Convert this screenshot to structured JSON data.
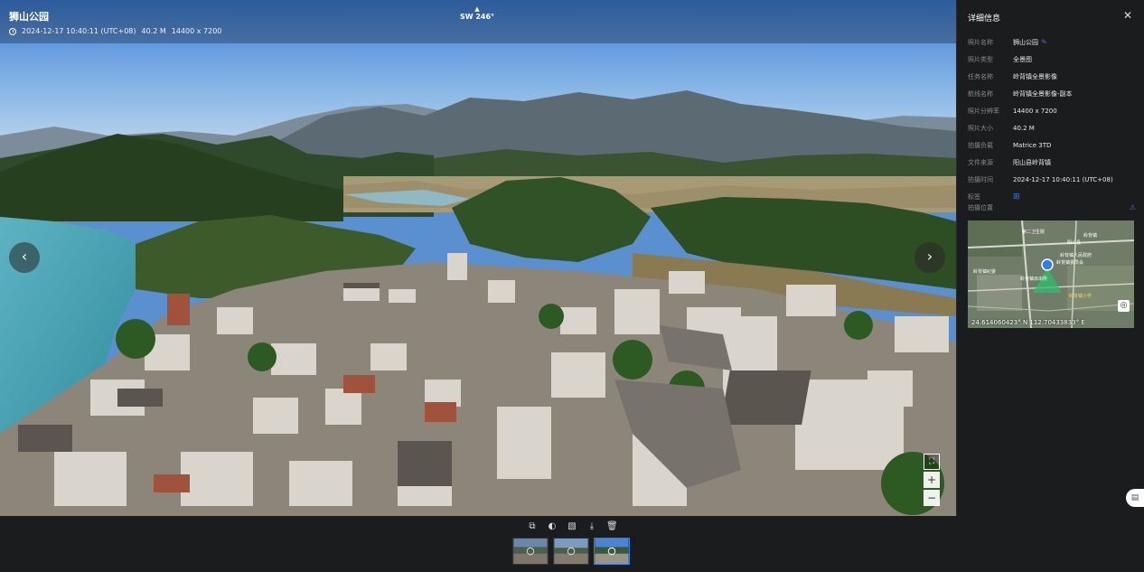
{
  "viewer": {
    "title": "狮山公园",
    "datetime": "2024-12-17 10:40:11 (UTC+08)",
    "size": "40.2 M",
    "resolution": "14400 x 7200",
    "compass_arrow": "▲",
    "compass": "SW 246°",
    "prev_label": "‹",
    "next_label": "›",
    "fullscreen_label": "⛶",
    "zoom_in_label": "+",
    "zoom_out_label": "−"
  },
  "panel": {
    "title": "详细信息",
    "close_label": "✕",
    "rows": [
      {
        "label": "照片名称",
        "value": "狮山公园"
      },
      {
        "label": "照片类型",
        "value": "全景图"
      },
      {
        "label": "任务名称",
        "value": "岭背镇全景影像"
      },
      {
        "label": "航线名称",
        "value": "岭背镇全景影像-副本"
      },
      {
        "label": "照片分辨率",
        "value": "14400 x 7200"
      },
      {
        "label": "照片大小",
        "value": "40.2 M"
      },
      {
        "label": "拍摄负载",
        "value": "Matrice 3TD"
      },
      {
        "label": "文件来源",
        "value": "阳山县岭背镇"
      },
      {
        "label": "拍摄时间",
        "value": "2024-12-17 10:40:11 (UTC+08)"
      },
      {
        "label": "标签",
        "value": ""
      }
    ],
    "location_label": "拍摄位置",
    "coordinates": "24.614060423° N  112.70433833° E",
    "map_labels": [
      "岭背镇",
      "阳山县",
      "第二卫生院",
      "岭背镇人民政府",
      "岭背镇委员会",
      "岭背镇纪委",
      "岭背镇派出所",
      "岭背镇小学"
    ]
  },
  "icons": {
    "pencil": "✎",
    "tag": "⊞",
    "warn": "⚠",
    "locate": "◎",
    "chat": "▤"
  },
  "toolbar": {
    "tools": [
      "⧉",
      "◐",
      "▧",
      "⤓",
      "🗑"
    ]
  }
}
